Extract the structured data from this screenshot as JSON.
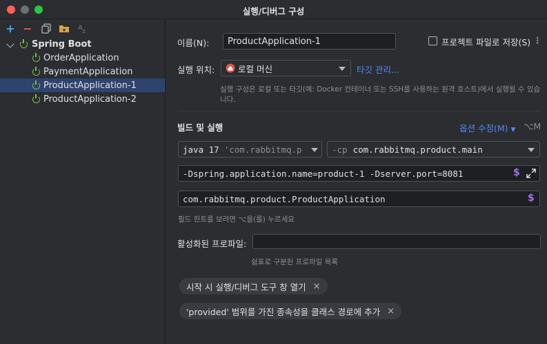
{
  "window": {
    "title": "실행/디버그 구성"
  },
  "toolbar": {
    "add": "+",
    "remove": "−"
  },
  "tree": {
    "group_label": "Spring Boot",
    "items": [
      {
        "label": "OrderApplication",
        "selected": false
      },
      {
        "label": "PaymentApplication",
        "selected": false
      },
      {
        "label": "ProductApplication-1",
        "selected": true
      },
      {
        "label": "ProductApplication-2",
        "selected": false
      }
    ]
  },
  "form": {
    "name_label": "이름(N):",
    "name_value": "ProductApplication-1",
    "save_to_project_label": "프로젝트 파일로 저장(S)",
    "save_to_project_checked": false,
    "location_label": "실행 위치:",
    "location_value": "로컬 머신",
    "manage_targets_link": "타깃 관리...",
    "location_hint": "실행 구성은 로컬 또는 타깃(예: Docker 컨테이너 또는 SSH를 사용하는 원격 호스트)에서 실행될 수 있습니다.",
    "build_run_header": "빌드 및 실행",
    "modify_options_link": "옵션 수정(M)",
    "modify_options_shortcut": "⌥M",
    "jdk_value": "java 17",
    "jdk_detail": "'com.rabbitmq.p",
    "cp_prefix": "-cp",
    "cp_value": "com.rabbitmq.product.main",
    "vm_options_value": "-Dspring.application.name=product-1 -Dserver.port=8081",
    "main_class_value": "com.rabbitmq.product.ProductApplication",
    "field_hint": "필드 힌트를 보려면 ⌥을(를) 누르세요",
    "profiles_label": "활성화된 프로파일:",
    "profiles_value": "",
    "profiles_hint": "쉼표로 구분된 프로파일 목록",
    "chips": [
      "시작 시 실행/디버그 도구 창 열기",
      "'provided' 범위를 가진 종속성을 클래스 경로에 추가"
    ],
    "dollar_symbol": "$",
    "chip_close": "×",
    "kebab": "⋮"
  },
  "colors": {
    "accent_link": "#548af7",
    "selection": "#2e436e",
    "spring_green": "#7fbf4a",
    "macro_purple": "#a071e6"
  }
}
